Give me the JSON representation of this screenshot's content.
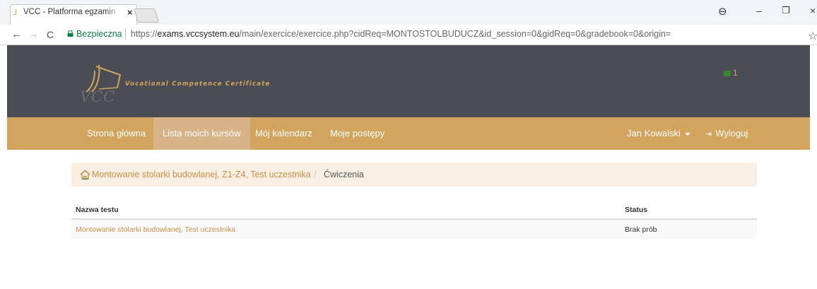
{
  "browser": {
    "tab_title": "VCC - Platforma egzamin",
    "secure_label": "Bezpieczna",
    "url_scheme": "https://",
    "url_host": "exams.vccsystem.eu",
    "url_path": "/main/exercice/exercice.php?cidReq=MONTOSTOLBUDUCZ&id_session=0&gidReq=0&gradebook=0&origin="
  },
  "header": {
    "logo_text": "VCC",
    "tagline": "Vocational Competence Certificate",
    "notification_count": "1"
  },
  "nav": {
    "home": "Strona główna",
    "courses": "Lista moich kursów",
    "calendar": "Mój kalendarz",
    "progress": "Moje postępy",
    "user": "Jan Kowalski",
    "logout": "Wyloguj"
  },
  "breadcrumb": {
    "course": "Montowanie stolarki budowlanej, Z1-Z4, Test uczestnika",
    "separator": "/",
    "current": "Ćwiczenia"
  },
  "table": {
    "headers": {
      "name": "Nazwa testu",
      "status": "Status"
    },
    "rows": [
      {
        "name": "Montowanie stolarki budowlanej, Test uczestnika",
        "status": "Brak prób"
      }
    ]
  },
  "colors": {
    "accent": "#d3a45d",
    "header_bg": "#4a4d53",
    "link": "#c8904a",
    "breadcrumb_bg": "#f9efe2"
  }
}
